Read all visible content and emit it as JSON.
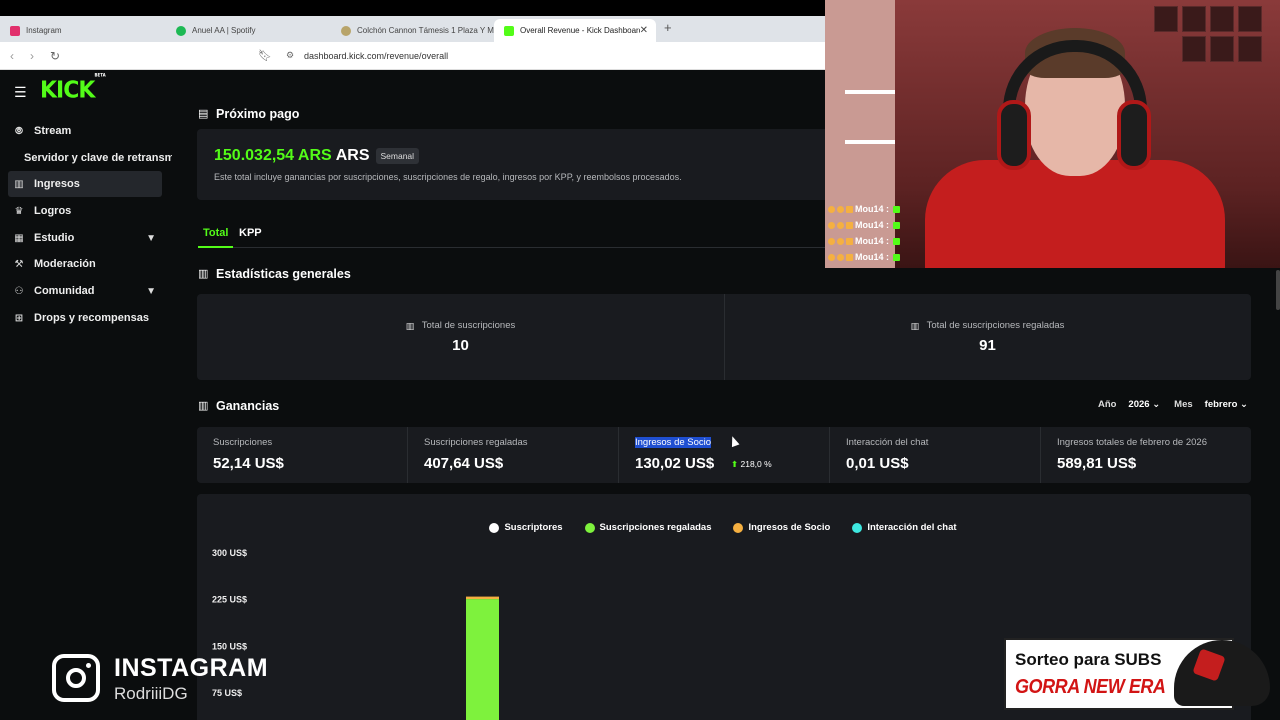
{
  "browser": {
    "tabs": [
      {
        "label": "Instagram",
        "color": "#e1306c"
      },
      {
        "label": "Anuel AA | Spotify",
        "color": "#1db954"
      },
      {
        "label": "Colchón Cannon Támesis 1 Plaza Y M",
        "color": "#b8a46a"
      },
      {
        "label": "Overall Revenue - Kick Dashboard",
        "color": "#53fc18",
        "active": true
      }
    ],
    "url": "dashboard.kick.com/revenue/overall"
  },
  "sidebar": {
    "logo": "KICK",
    "logo_badge": "BETA",
    "items": [
      {
        "label": "Stream",
        "icon": "broadcast-icon"
      },
      {
        "label": "Servidor y clave de retransmisión",
        "sub": true
      },
      {
        "label": "Ingresos",
        "icon": "chart-icon",
        "active": true
      },
      {
        "label": "Logros",
        "icon": "trophy-icon"
      },
      {
        "label": "Estudio",
        "icon": "studio-icon",
        "chevron": true
      },
      {
        "label": "Moderación",
        "icon": "wrench-icon"
      },
      {
        "label": "Comunidad",
        "icon": "community-icon",
        "chevron": true
      },
      {
        "label": "Drops y recompensas",
        "icon": "gift-icon"
      }
    ]
  },
  "payout": {
    "title": "Próximo pago",
    "amount": "150.032,54 ARS",
    "currency": "ARS",
    "badge": "Semanal",
    "description": "Este total incluye ganancias por suscripciones, suscripciones de regalo, ingresos por KPP, y reembolsos procesados."
  },
  "tabs": [
    "Total",
    "KPP"
  ],
  "stats": {
    "title": "Estadísticas generales",
    "items": [
      {
        "label": "Total de suscripciones",
        "value": "10"
      },
      {
        "label": "Total de suscripciones regaladas",
        "value": "91"
      }
    ]
  },
  "earnings": {
    "title": "Ganancias",
    "year_label": "Año",
    "year": "2026",
    "month_label": "Mes",
    "month": "febrero",
    "items": [
      {
        "label": "Suscripciones",
        "value": "52,14 US$"
      },
      {
        "label": "Suscripciones regaladas",
        "value": "407,64 US$"
      },
      {
        "label": "Ingresos de Socio",
        "value": "130,02 US$",
        "growth": "218,0 %"
      },
      {
        "label": "Interacción del chat",
        "value": "0,01 US$"
      },
      {
        "label": "Ingresos totales de febrero de 2026",
        "value": "589,81 US$"
      }
    ]
  },
  "chart_data": {
    "type": "bar",
    "series": [
      {
        "name": "Suscriptores",
        "color": "#ffffff"
      },
      {
        "name": "Suscripciones regaladas",
        "color": "#7ef23d"
      },
      {
        "name": "Ingresos de Socio",
        "color": "#f5b041"
      },
      {
        "name": "Interacción del chat",
        "color": "#3ee8e0"
      }
    ],
    "yticks": [
      "300 US$",
      "225 US$",
      "150 US$",
      "75 US$"
    ],
    "ylim": [
      0,
      300
    ],
    "bars": [
      {
        "stack": [
          {
            "series": "Suscripciones regaladas",
            "value": 226
          },
          {
            "series": "Ingresos de Socio",
            "value": 4
          }
        ]
      }
    ]
  },
  "webcam": {
    "chat": [
      "Mou14 :",
      "Mou14 :",
      "Mou14 :",
      "Mou14 :"
    ]
  },
  "overlay": {
    "instagram_title": "INSTAGRAM",
    "instagram_handle": "RodriiiDG",
    "sorteo_line1": "Sorteo para SUBS",
    "sorteo_line2": "GORRA NEW ERA"
  },
  "colors": {
    "accent": "#53fc18",
    "background": "#0b0d0e",
    "card": "#191b1f"
  }
}
